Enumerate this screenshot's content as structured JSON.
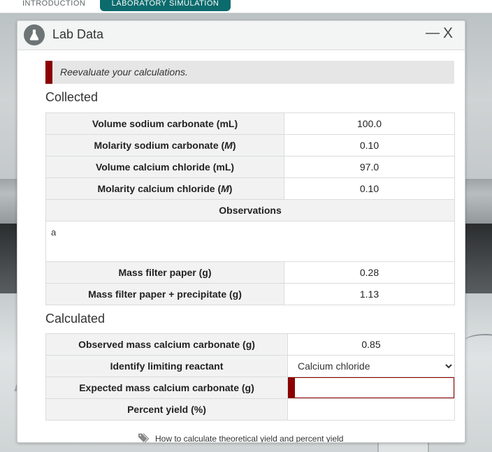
{
  "tabs": {
    "introduction": "INTRODUCTION",
    "lab_simulation": "LABORATORY SIMULATION"
  },
  "panel": {
    "title": "Lab Data",
    "minimize_label": "—",
    "close_label": "X",
    "icon": "flask-icon"
  },
  "alert": {
    "message": "Reevaluate your calculations.",
    "accent_color": "#8b0000"
  },
  "collected": {
    "heading": "Collected",
    "rows": [
      {
        "label_pre": "Volume sodium carbonate (mL)",
        "label_italic": "",
        "label_post": "",
        "value": "100.0"
      },
      {
        "label_pre": "Molarity sodium carbonate (",
        "label_italic": "M",
        "label_post": ")",
        "value": "0.10"
      },
      {
        "label_pre": "Volume calcium chloride (mL)",
        "label_italic": "",
        "label_post": "",
        "value": "97.0"
      },
      {
        "label_pre": "Molarity calcium chloride (",
        "label_italic": "M",
        "label_post": ")",
        "value": "0.10"
      }
    ],
    "observations_label": "Observations",
    "observations_value": "a",
    "rows2": [
      {
        "label": "Mass filter paper (g)",
        "value": "0.28"
      },
      {
        "label": "Mass filter paper + precipitate (g)",
        "value": "1.13"
      }
    ]
  },
  "calculated": {
    "heading": "Calculated",
    "observed_label": "Observed mass calcium carbonate (g)",
    "observed_value": "0.85",
    "limiting_label": "Identify limiting reactant",
    "limiting_selected": "Calcium chloride",
    "expected_label": "Expected mass calcium carbonate (g)",
    "expected_value": "",
    "percent_label": "Percent yield (%)",
    "percent_value": ""
  },
  "help_link": {
    "text": "How to calculate theoretical yield and percent yield",
    "icon": "tag-icon"
  },
  "colors": {
    "tab_active": "#0b6b6d",
    "error": "#8b0000"
  }
}
